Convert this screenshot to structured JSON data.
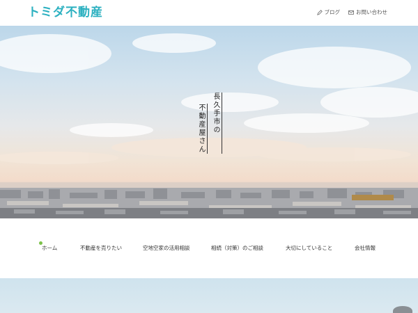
{
  "header": {
    "logo": "トミダ不動産",
    "links": [
      {
        "label": "ブログ",
        "icon": "pencil-icon"
      },
      {
        "label": "お問い合わせ",
        "icon": "mail-icon"
      }
    ]
  },
  "hero": {
    "tagline_line1": "長久手市の",
    "tagline_line2": "不動産屋さん"
  },
  "nav": {
    "items": [
      {
        "label": "ホーム"
      },
      {
        "label": "不動産を売りたい"
      },
      {
        "label": "空地空家の活用相談"
      },
      {
        "label": "相続（対策）のご相談"
      },
      {
        "label": "大切にしていること"
      },
      {
        "label": "会社情報"
      }
    ],
    "active_color": "#7cc24a"
  },
  "colors": {
    "brand": "#2bb0c0"
  }
}
